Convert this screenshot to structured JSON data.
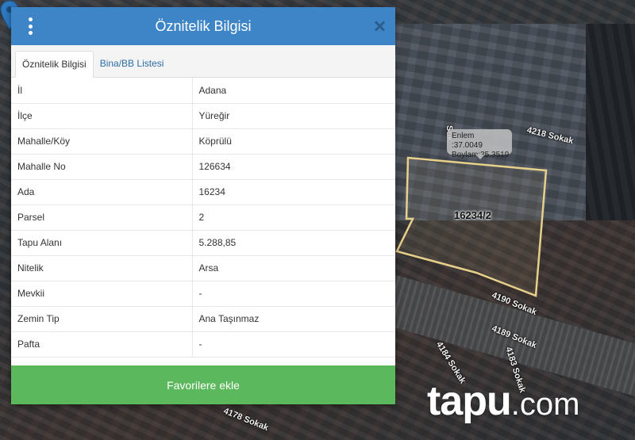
{
  "panel": {
    "title": "Öznitelik Bilgisi",
    "tabs": [
      {
        "label": "Öznitelik Bilgisi",
        "active": true
      },
      {
        "label": "Bina/BB Listesi",
        "active": false
      }
    ],
    "rows": [
      {
        "key": "İl",
        "value": "Adana"
      },
      {
        "key": "İlçe",
        "value": "Yüreğir"
      },
      {
        "key": "Mahalle/Köy",
        "value": "Köprülü"
      },
      {
        "key": "Mahalle No",
        "value": "126634"
      },
      {
        "key": "Ada",
        "value": "16234"
      },
      {
        "key": "Parsel",
        "value": "2"
      },
      {
        "key": "Tapu Alanı",
        "value": "5.288,85"
      },
      {
        "key": "Nitelik",
        "value": "Arsa"
      },
      {
        "key": "Mevkii",
        "value": "-"
      },
      {
        "key": "Zemin Tip",
        "value": "Ana Taşınmaz"
      },
      {
        "key": "Pafta",
        "value": "-"
      }
    ],
    "favorite_button": "Favorilere ekle"
  },
  "map": {
    "coordinates": {
      "lat": "Enlem :37.0049",
      "lon": "Boylam:35.3519"
    },
    "parcel_label": "16234/2",
    "streets": {
      "s4218": "4218 Sokak",
      "s4190": "4190 Sokak",
      "s4189": "4189 Sokak",
      "s4184": "4184 Sokak",
      "s4183": "4183 Sokak",
      "s4178": "4178 Sokak",
      "partial": "Sok"
    },
    "parcel_color": "#e6d08a",
    "pin_color": "#2e78c2"
  },
  "brand": {
    "name": "tapu",
    "suffix": ".com"
  },
  "colors": {
    "header": "#3d85c6",
    "button": "#5cb85c"
  }
}
